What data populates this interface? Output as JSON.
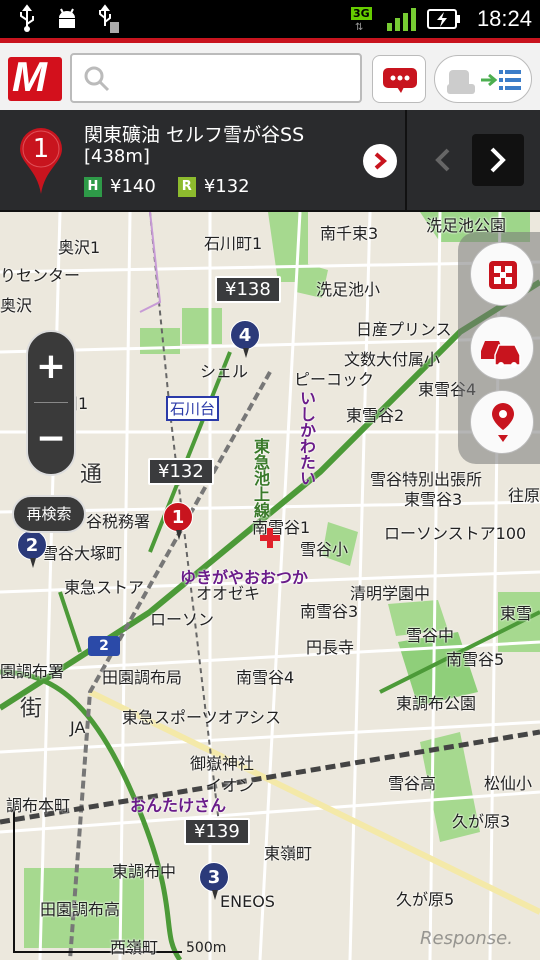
{
  "status_bar": {
    "network": "3G",
    "time": "18:24"
  },
  "search": {
    "placeholder": ""
  },
  "info_panel": {
    "marker_number": "1",
    "station_name": "関東礦油 セルフ雪が谷SS",
    "distance": "[438m]",
    "prices": [
      {
        "tag": "H",
        "price": "¥140",
        "color": "#2e9a48"
      },
      {
        "tag": "R",
        "price": "¥132",
        "color": "#8dbb2e"
      }
    ]
  },
  "map": {
    "markers": [
      {
        "num": "4",
        "price": "¥138",
        "color": "blue"
      },
      {
        "num": "1",
        "price": "¥132",
        "color": "red"
      },
      {
        "num": "2",
        "price": "",
        "color": "blue"
      },
      {
        "num": "3",
        "price": "¥139",
        "color": "blue"
      }
    ],
    "research_label": "再検索",
    "route_badge": "2",
    "scale": "500m",
    "watermark": "Response.",
    "labels": {
      "okusawa1": "奥沢1",
      "ishikawa1": "石川町1",
      "minami_senzoku3": "南千束3",
      "senzokuike_park": "洗足池公園",
      "center": "りセンター",
      "okusawa": "奥沢",
      "senzokuike_sho": "洗足池小",
      "nisshin": "日産プリンス",
      "moji_daiko": "文数大付属小",
      "shell": "シェル",
      "peacock": "ピーコック",
      "higashi_yukigaya4": "東雪谷4",
      "ishikawadai_station": "石川台",
      "okutamagawa1": "奥玉川1",
      "higashi_yukigaya2": "東雪谷2",
      "ishikawatai": "いしかわたい",
      "tokyu_ikegami": "東急池上線",
      "yukigaya_tokubetsu": "雪谷特別出張所",
      "higashi_yukigaya3": "東雪谷3",
      "ohara": "往原",
      "zeimusho": "谷税務署",
      "minami_yukigaya1": "南雪谷1",
      "lawson100": "ローソンストア100",
      "yukigaya_otsuka": "雪谷大塚町",
      "yukigaya_sho": "雪谷小",
      "yukigaya_otsuka_station": "ゆきがやおおつか",
      "tokyu_store": "東急ストア",
      "oozeki": "オオゼキ",
      "seimei": "清明学園中",
      "lawson": "ローソン",
      "minami_yukigaya3": "南雪谷3",
      "yukigaya_chu": "雪谷中",
      "higashi_yukigaya5": "東雪",
      "chochoji": "円長寺",
      "minami_yukigaya5": "南雪谷5",
      "denen_post": "田園調布局",
      "minami_yukigaya4": "南雪谷4",
      "denenchofu_park": "東調布公園",
      "denen_post2": "園調布署",
      "tokyu_sports": "東急スポーツオアシス",
      "ja": "JA",
      "mitake_jinja": "御嶽神社",
      "aeon": "イオン",
      "ontakesan": "おんたけさん",
      "yukigaya_ko": "雪谷高",
      "matsunaka": "松仙小",
      "denen_honcho": "調布本町",
      "kugahara3": "久が原3",
      "higashi_chofu_chu": "東調布中",
      "higashi_mine": "東嶺町",
      "eneos": "ENEOS",
      "denenchofu_ko": "田園調布高",
      "kugahara5": "久が原5",
      "nishimine": "西嶺町",
      "machi": "街",
      "dori": "通"
    }
  }
}
